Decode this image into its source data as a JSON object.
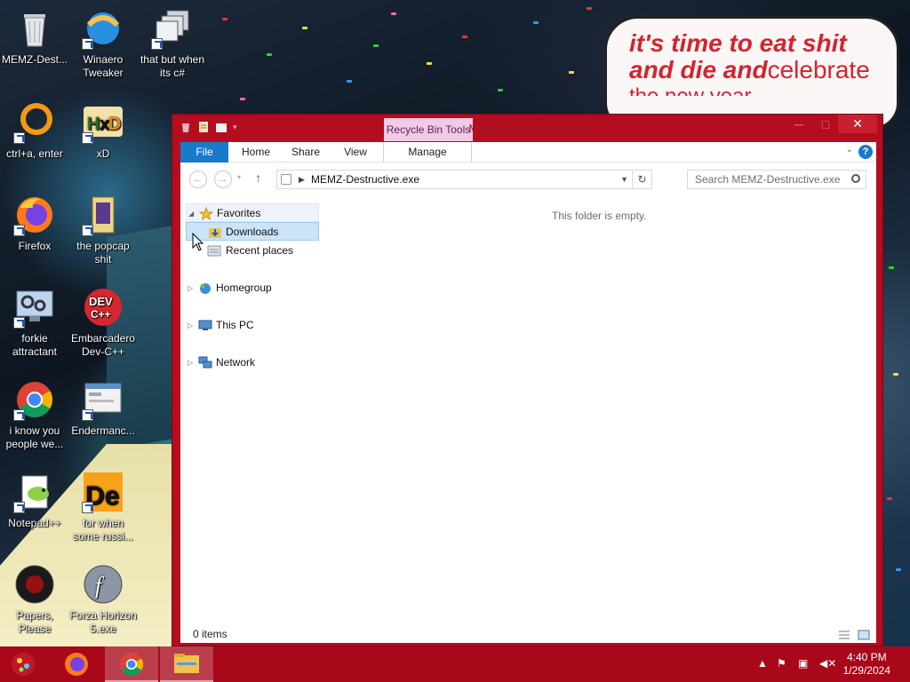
{
  "speech_bubble": {
    "line1": "it's time to eat shit",
    "line2a": "and die and",
    "line2b": "celebrate",
    "line3": "the new year"
  },
  "desktop_icons": [
    {
      "label": "MEMZ-Dest...",
      "icon": "recycle-bin-icon"
    },
    {
      "label": "Winaero Tweaker",
      "icon": "winaero-icon"
    },
    {
      "label": "that but when its c#",
      "icon": "stacked-windows-icon"
    },
    {
      "label": "ctrl+a, enter",
      "icon": "orange-ring-icon"
    },
    {
      "label": "xD",
      "icon": "hxd-icon"
    },
    {
      "label": "Firefox",
      "icon": "firefox-icon"
    },
    {
      "label": "the popcap shit",
      "icon": "popcap-icon"
    },
    {
      "label": "forkie attractant",
      "icon": "monitor-gear-icon"
    },
    {
      "label": "Embarcadero Dev-C++",
      "icon": "devcpp-icon"
    },
    {
      "label": "i know you people we...",
      "icon": "chrome-icon"
    },
    {
      "label": "Endermanc...",
      "icon": "window-app-icon"
    },
    {
      "label": "Notepad++",
      "icon": "notepadpp-icon"
    },
    {
      "label": "for when some russi...",
      "icon": "de-icon"
    },
    {
      "label": "Papers, Please",
      "icon": "papers-please-icon"
    },
    {
      "label": "Forza Horizon 5.exe",
      "icon": "flash-icon"
    }
  ],
  "window": {
    "title": "MEMZ-Destructive.exe",
    "context_tab": "Recycle Bin Tools",
    "ribbon_tabs": [
      "File",
      "Home",
      "Share",
      "View",
      "Manage"
    ],
    "address_path": "MEMZ-Destructive.exe",
    "search_placeholder": "Search MEMZ-Destructive.exe",
    "nav": {
      "favorites": "Favorites",
      "downloads": "Downloads",
      "recent": "Recent places",
      "homegroup": "Homegroup",
      "thispc": "This PC",
      "network": "Network"
    },
    "empty_message": "This folder is empty.",
    "status": "0 items"
  },
  "taskbar": {
    "time": "4:40 PM",
    "date": "1/29/2024"
  },
  "colors": {
    "window_frame": "#b30d1f",
    "taskbar": "#a8081a",
    "accent_blue": "#1979ca",
    "bubble_text": "#d4242f",
    "context_tab": "#f2c9e6"
  }
}
